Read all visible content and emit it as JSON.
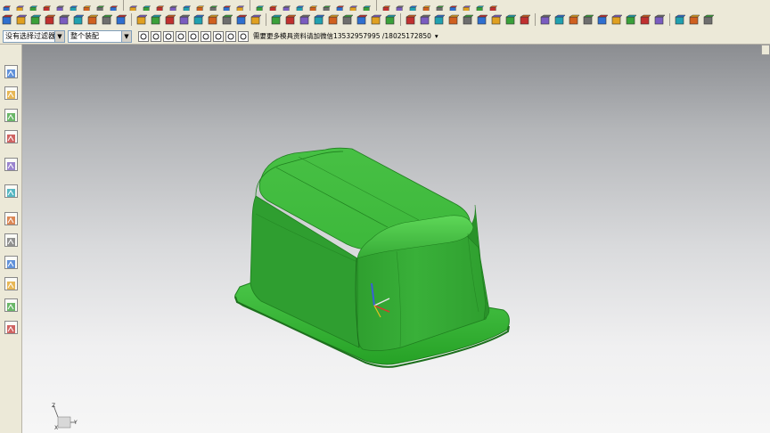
{
  "selection_bar": {
    "filter_value": "没有选择过滤器",
    "assembly_value": "整个装配",
    "hint_text": "需要更多模具资料请加微信13532957995 /18025172850"
  },
  "icons": {
    "toolbar_top": [
      "new-icon",
      "open-icon",
      "save-icon",
      "cut-icon",
      "copy-icon",
      "paste-icon",
      "undo-icon",
      "redo-icon",
      "block-icon",
      "cylinder-icon",
      "cone-icon",
      "sphere-icon",
      "extrude-icon",
      "revolve-icon",
      "hole-icon",
      "boss-icon",
      "pocket-icon",
      "pad-icon",
      "slot-icon",
      "groove-icon",
      "blend-icon",
      "chamfer-icon",
      "shell-icon",
      "draft-icon",
      "trim-icon",
      "split-icon",
      "sew-icon",
      "patch-icon",
      "sphere-yellow-icon",
      "render-icon",
      "analysis-icon",
      "measure-icon",
      "section-icon",
      "view-icon",
      "layer-icon",
      "mold-icon"
    ],
    "toolbar_middle": [
      "sketch-icon",
      "point-icon",
      "datum-plane-icon",
      "block-icon",
      "color-icon",
      "align-icon",
      "box-red-icon",
      "rectangle-icon",
      "arc-icon",
      "mirror-icon",
      "pattern-icon",
      "move-icon",
      "unite-icon",
      "subtract-icon",
      "intersect-icon",
      "rotate-icon",
      "axis-icon",
      "f8-icon",
      "xz-icon",
      "fit-icon",
      "zoom-icon",
      "pan-icon",
      "view-front-icon",
      "view-top-icon",
      "view-right-icon",
      "view-iso-icon",
      "shaded-icon",
      "wireframe-icon",
      "hidden-line-icon",
      "studio-icon",
      "perspective-icon",
      "grid-icon",
      "snap-grid-icon",
      "red-cube-icon",
      "table-icon",
      "circle-icon",
      "bolt-icon",
      "stack-icon",
      "spring-icon",
      "cap-icon",
      "pin-icon",
      "ejector-icon",
      "plate-icon",
      "insert-icon",
      "cooling-icon",
      "slide-icon",
      "lifter-icon",
      "gate-icon"
    ],
    "snap_bar": [
      "end-point-icon",
      "mid-point-icon",
      "control-point-icon",
      "intersection-icon",
      "arc-center-icon",
      "quadrant-icon",
      "point-on-curve-icon",
      "point-on-face-icon",
      "bounded-grid-icon"
    ],
    "sidebar": [
      "assembly-navigator-icon",
      "constraint-navigator-icon",
      "part-navigator-icon",
      "reuse-library-icon",
      "web-browser-icon",
      "history-icon",
      "process-studio-icon",
      "visualization-icon",
      "roles-icon",
      "system-materials-icon",
      "hd3d-icon",
      "cam-icon"
    ]
  },
  "colors": {
    "part_green": "#3cb53c",
    "part_dark_green": "#2a8f2a",
    "part_light_green": "#5fd45a",
    "viewport_top": "#8b8d91",
    "viewport_bottom": "#f6f6f6",
    "toolbar_bg": "#ece9d8"
  },
  "viewport": {
    "triad_axes": [
      "X",
      "Y",
      "Z"
    ]
  }
}
